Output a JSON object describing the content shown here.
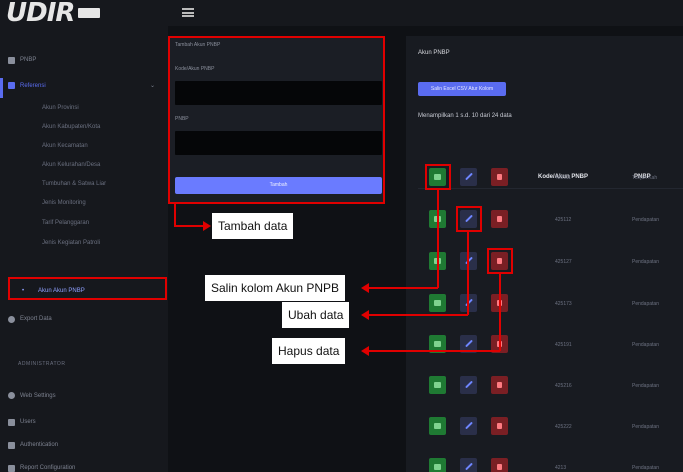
{
  "app": {
    "logo_text": "UDIR",
    "topbar_menu_icon": "hamburger-icon"
  },
  "sidebar": {
    "items": [
      {
        "label": "PNBP",
        "icon": "grid-icon"
      },
      {
        "label": "Referensi",
        "icon": "list-icon",
        "expanded": true
      }
    ],
    "sub_items": [
      "Akun Provinsi",
      "Akun Kabupaten/Kota",
      "Akun Kecamatan",
      "Akun Kelurahan/Desa",
      "Tumbuhan & Satwa Liar",
      "Jenis Monitoring",
      "Tarif Pelanggaran",
      "Jenis Kegiatan Patroli",
      "Akun Akun PNBP"
    ],
    "share_item": "Export Data",
    "admin_section": "ADMINISTRATOR",
    "admin_items": [
      {
        "label": "Web Settings",
        "icon": "gear-icon"
      },
      {
        "label": "Users",
        "icon": "users-icon"
      },
      {
        "label": "Authentication",
        "icon": "shield-icon"
      },
      {
        "label": "Report Configuration",
        "icon": "doc-icon"
      }
    ]
  },
  "form": {
    "header": "Tambah Akun PNBP",
    "code_label": "Kode/Akun PNBP",
    "pnbp_label": "PNBP",
    "submit_label": "Tambah"
  },
  "table": {
    "title": "Akun PNBP",
    "export_buttons": "Salin   Excel   CSV   Atur Kolom",
    "info": "Menampilkan 1 s.d. 10 dari 24 data",
    "headers": {
      "no": "#",
      "code": "Kode/Akun PNBP",
      "pnbp": "PNBP"
    },
    "rows": [
      {
        "code": "425111",
        "pnbp": "Tunjuk Kah"
      },
      {
        "code": "425112",
        "pnbp": "Pendapatan"
      },
      {
        "code": "425127",
        "pnbp": "Pendapatan"
      },
      {
        "code": "425173",
        "pnbp": "Pendapatan"
      },
      {
        "code": "425191",
        "pnbp": "Pendapatan"
      },
      {
        "code": "425216",
        "pnbp": "Pendapatan"
      },
      {
        "code": "425222",
        "pnbp": "Pendapatan"
      },
      {
        "code": "4213",
        "pnbp": "Pendapatan"
      }
    ]
  },
  "annotations": {
    "tambah": "Tambah data",
    "salin": "Salin kolom Akun PNPB",
    "ubah": "Ubah data",
    "hapus": "Hapus data",
    "highlight_color": "#e00000"
  }
}
